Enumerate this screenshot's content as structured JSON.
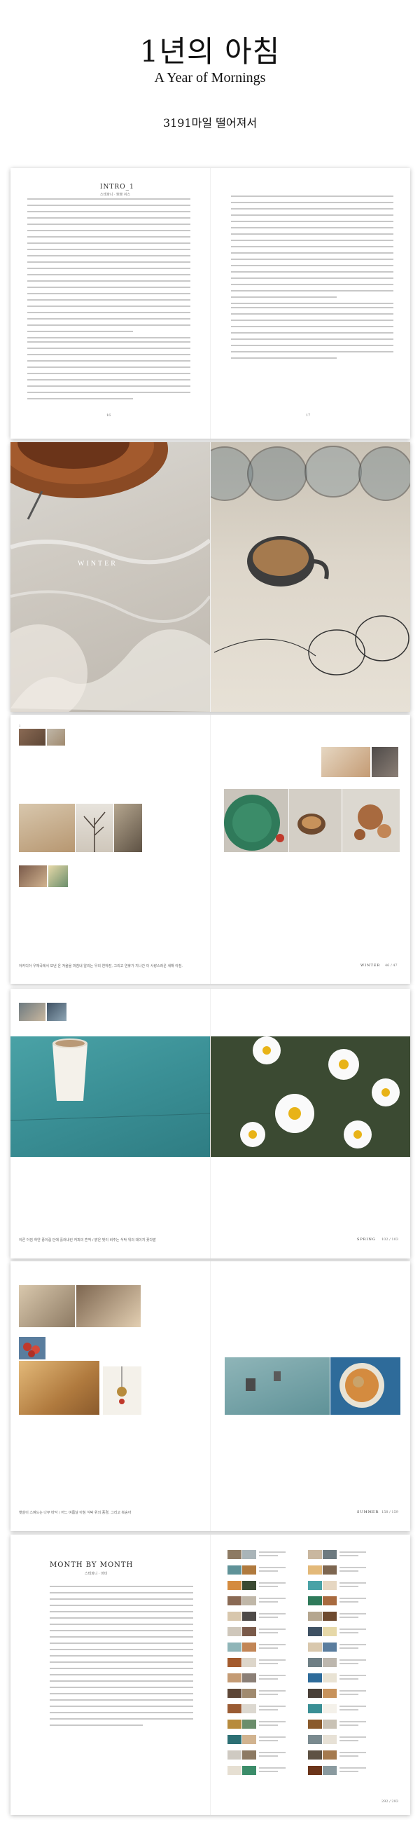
{
  "header": {
    "title_ko": "1년의 아침",
    "title_en": "A Year of Mornings",
    "author": "3191마일 떨어져서"
  },
  "spread1": {
    "heading": "INTRO_1",
    "subheading": "스테파니 · 뽀뽀 쉬스",
    "folio_left": "16",
    "folio_right": "17"
  },
  "spread2": {
    "season_label": "WINTER"
  },
  "spread3": {
    "caption": "아카디아 우체국에서 보낸 온 겨울을 마침내 알리는 우리 연하장, 그리고 연휴가 지나간 이 사랑스러운 새해 아침.",
    "section": "WINTER",
    "folio": "46 / 47"
  },
  "spread4": {
    "caption": "이른 아침 하얀 종이컵 안에 흘러내린 커피의 흔적 / 밝은 빛이 비추는 식탁 위의 데이지 꽃다발",
    "section": "SPRING",
    "folio": "102 / 103"
  },
  "spread5": {
    "caption": "햇살이 스며드는 나무 바닥 / 어느 여름날 아침 식탁 위의 풍경, 그리고 복숭아",
    "section": "SUMMER",
    "folio": "158 / 159"
  },
  "spread6": {
    "heading": "MONTH BY MONTH",
    "subheading": "스테파니 · 마미",
    "folio": "292 / 293"
  }
}
